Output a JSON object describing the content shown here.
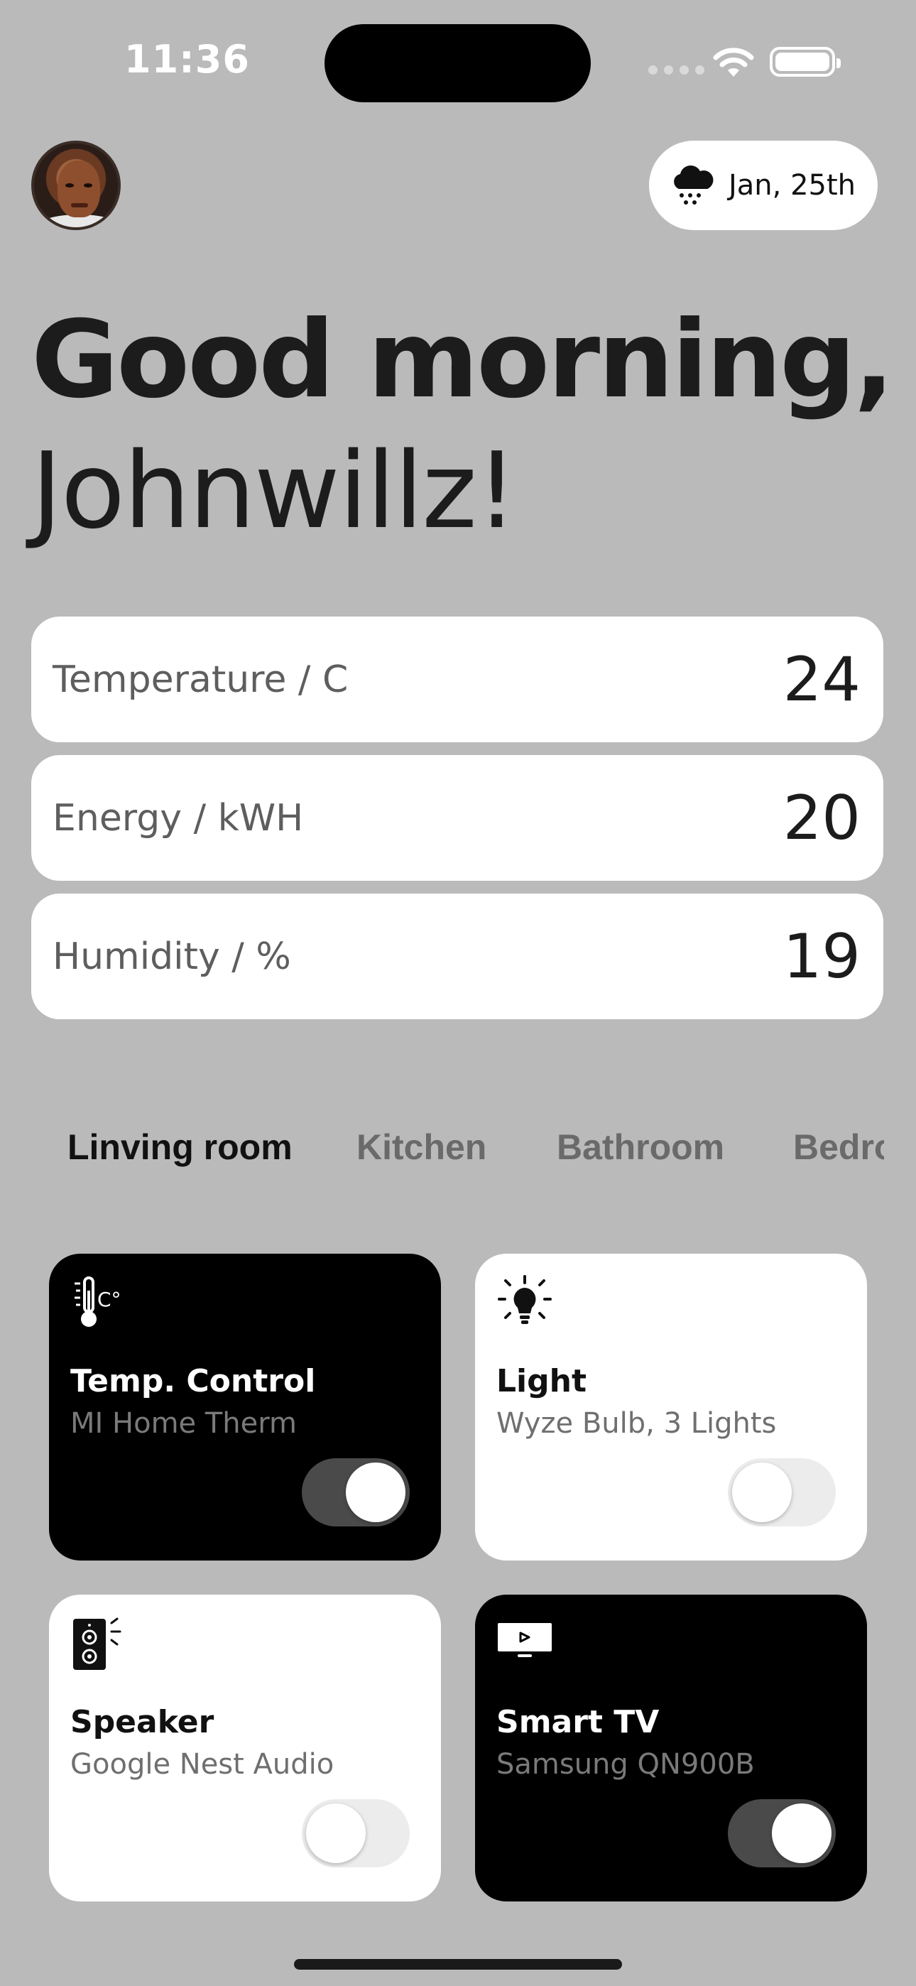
{
  "status_bar": {
    "time": "11:36"
  },
  "header": {
    "date": "Jan, 25th",
    "date_icon": "snow-cloud-icon",
    "avatar": "user-avatar"
  },
  "greeting": {
    "line1": "Good morning,",
    "line2": "Johnwillz!"
  },
  "stats": [
    {
      "label": "Temperature / C",
      "value": "24"
    },
    {
      "label": "Energy / kWH",
      "value": "20"
    },
    {
      "label": "Humidity / %",
      "value": "19"
    }
  ],
  "rooms": {
    "active": "Linving room",
    "tabs": [
      {
        "label": "Linving room"
      },
      {
        "label": "Kitchen"
      },
      {
        "label": "Bathroom"
      },
      {
        "label": "Bedroom"
      }
    ]
  },
  "devices": [
    {
      "title": "Temp. Control",
      "subtitle": "MI Home Therm",
      "icon": "thermometer-icon",
      "theme": "dark",
      "on": true
    },
    {
      "title": "Light",
      "subtitle": "Wyze Bulb, 3 Lights",
      "icon": "light-bulb-icon",
      "theme": "light",
      "on": false
    },
    {
      "title": "Speaker",
      "subtitle": "Google Nest Audio",
      "icon": "speaker-icon",
      "theme": "light",
      "on": false
    },
    {
      "title": "Smart TV",
      "subtitle": "Samsung QN900B",
      "icon": "tv-icon",
      "theme": "dark",
      "on": true
    }
  ],
  "colors": {
    "background": "#bababa",
    "card_dark": "#000000",
    "card_light": "#ffffff",
    "toggle_on": "#4a4a4a",
    "toggle_off": "#ececec"
  }
}
